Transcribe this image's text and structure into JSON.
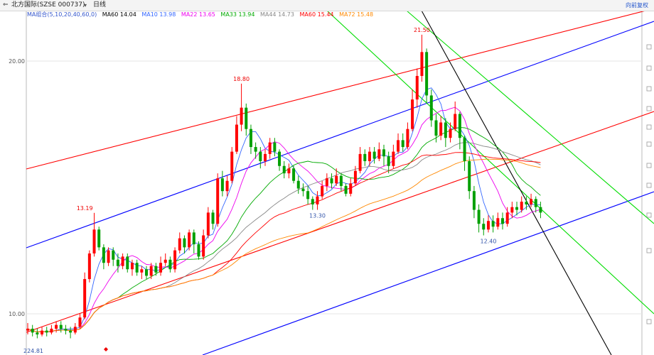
{
  "toolbar": {
    "back_glyph": "⇐",
    "title": "北方国际(SZSE 000737)",
    "period": "日线",
    "adjust_label": "向前复权",
    "period_menu_icon": "chevron-down-icon"
  },
  "ma_legend": {
    "group": "MA组合(5,10,20,40,60,0)",
    "items": [
      {
        "label": "MA60 14.04",
        "color": "#000000"
      },
      {
        "label": "MA10 13.98",
        "color": "#3366ff"
      },
      {
        "label": "MA22 13.65",
        "color": "#ee00ee"
      },
      {
        "label": "MA33 13.94",
        "color": "#00aa00"
      },
      {
        "label": "MA44 14.73",
        "color": "#888888"
      },
      {
        "label": "MA60 15.44",
        "color": "#ff0000"
      },
      {
        "label": "MA72 15.48",
        "color": "#ff8800"
      }
    ]
  },
  "colors": {
    "up": "#ff0000",
    "down": "#00a000",
    "channel_red": "#ff0000",
    "channel_blue": "#0000ff",
    "fan_green": "#00dd00",
    "trend_black": "#000000"
  },
  "chart_data": {
    "type": "candlestick",
    "y_scale": "log",
    "ylim": [
      9.1,
      23.5
    ],
    "y_ticks": [
      10.0,
      20.0
    ],
    "y_tick_labels": [
      "10.00",
      "20.00"
    ],
    "peak_labels": [
      {
        "label": "13.19",
        "day": 12,
        "value": 13.19
      },
      {
        "label": "18.80",
        "day": 45,
        "value": 18.8
      },
      {
        "label": "13.30",
        "day": 61,
        "value": 13.3
      },
      {
        "label": "21.50",
        "day": 83,
        "value": 21.5
      },
      {
        "label": "12.40",
        "day": 97,
        "value": 12.4
      }
    ],
    "bottom_label": "224.81",
    "candles": [
      [
        9.55,
        9.6,
        9.75,
        9.45
      ],
      [
        9.6,
        9.5,
        9.7,
        9.4
      ],
      [
        9.5,
        9.45,
        9.6,
        9.35
      ],
      [
        9.45,
        9.55,
        9.65,
        9.4
      ],
      [
        9.55,
        9.5,
        9.65,
        9.4
      ],
      [
        9.5,
        9.6,
        9.7,
        9.45
      ],
      [
        9.6,
        9.7,
        9.8,
        9.5
      ],
      [
        9.7,
        9.6,
        9.8,
        9.5
      ],
      [
        9.6,
        9.55,
        9.7,
        9.45
      ],
      [
        9.55,
        9.5,
        9.65,
        9.35
      ],
      [
        9.5,
        9.65,
        9.75,
        9.45
      ],
      [
        9.65,
        9.9,
        10.0,
        9.6
      ],
      [
        9.9,
        11.0,
        11.2,
        9.85
      ],
      [
        11.0,
        11.8,
        11.9,
        10.9
      ],
      [
        11.8,
        12.6,
        13.19,
        11.7
      ],
      [
        12.6,
        12.0,
        12.7,
        11.9
      ],
      [
        12.0,
        11.5,
        12.1,
        11.3
      ],
      [
        11.5,
        11.9,
        12.0,
        11.4
      ],
      [
        11.9,
        11.6,
        12.0,
        11.4
      ],
      [
        11.6,
        11.4,
        11.8,
        11.2
      ],
      [
        11.4,
        11.7,
        11.8,
        11.3
      ],
      [
        11.7,
        11.3,
        11.8,
        11.2
      ],
      [
        11.3,
        11.5,
        11.6,
        11.1
      ],
      [
        11.5,
        11.2,
        11.6,
        11.1
      ],
      [
        11.2,
        11.3,
        11.4,
        11.0
      ],
      [
        11.3,
        11.1,
        11.4,
        11.0
      ],
      [
        11.1,
        11.4,
        11.5,
        11.0
      ],
      [
        11.4,
        11.2,
        11.5,
        11.1
      ],
      [
        11.2,
        11.5,
        11.7,
        11.1
      ],
      [
        11.5,
        11.6,
        11.8,
        11.4
      ],
      [
        11.6,
        11.3,
        11.7,
        11.2
      ],
      [
        11.3,
        11.9,
        12.0,
        11.2
      ],
      [
        11.9,
        12.3,
        12.5,
        11.8
      ],
      [
        12.3,
        12.0,
        12.4,
        11.8
      ],
      [
        12.0,
        12.5,
        12.6,
        11.9
      ],
      [
        12.5,
        12.1,
        12.6,
        11.8
      ],
      [
        12.1,
        11.7,
        12.2,
        11.6
      ],
      [
        11.7,
        12.4,
        12.6,
        11.6
      ],
      [
        12.4,
        13.2,
        13.4,
        12.3
      ],
      [
        13.2,
        12.8,
        13.3,
        12.6
      ],
      [
        12.8,
        14.5,
        14.7,
        12.7
      ],
      [
        14.5,
        14.0,
        14.8,
        13.8
      ],
      [
        14.0,
        14.4,
        14.6,
        13.8
      ],
      [
        14.4,
        15.6,
        15.8,
        14.3
      ],
      [
        15.6,
        16.8,
        17.2,
        15.5
      ],
      [
        16.8,
        17.6,
        18.8,
        16.5
      ],
      [
        17.6,
        16.6,
        17.8,
        16.3
      ],
      [
        16.6,
        15.8,
        16.8,
        15.5
      ],
      [
        15.8,
        15.6,
        16.0,
        15.3
      ],
      [
        15.6,
        15.2,
        15.8,
        14.9
      ],
      [
        15.2,
        15.5,
        15.7,
        15.0
      ],
      [
        15.5,
        16.0,
        16.2,
        15.3
      ],
      [
        16.0,
        15.6,
        16.2,
        15.4
      ],
      [
        15.6,
        15.0,
        15.7,
        14.8
      ],
      [
        15.0,
        14.7,
        15.2,
        14.5
      ],
      [
        14.7,
        14.9,
        15.1,
        14.5
      ],
      [
        14.9,
        14.4,
        15.0,
        14.3
      ],
      [
        14.4,
        14.1,
        14.6,
        13.9
      ],
      [
        14.1,
        14.0,
        14.3,
        13.8
      ],
      [
        14.0,
        13.7,
        14.2,
        13.5
      ],
      [
        13.7,
        13.5,
        13.8,
        13.3
      ],
      [
        13.5,
        13.8,
        14.0,
        13.3
      ],
      [
        13.8,
        14.2,
        14.4,
        13.7
      ],
      [
        14.2,
        14.5,
        14.7,
        14.0
      ],
      [
        14.5,
        14.3,
        14.7,
        14.1
      ],
      [
        14.3,
        14.6,
        14.9,
        14.2
      ],
      [
        14.6,
        14.2,
        14.7,
        14.0
      ],
      [
        14.2,
        13.9,
        14.3,
        13.8
      ],
      [
        13.9,
        14.3,
        14.5,
        13.8
      ],
      [
        14.3,
        14.8,
        15.0,
        14.2
      ],
      [
        14.8,
        15.5,
        15.8,
        14.7
      ],
      [
        15.5,
        15.2,
        15.7,
        15.0
      ],
      [
        15.2,
        15.6,
        15.8,
        15.0
      ],
      [
        15.6,
        15.3,
        15.8,
        15.1
      ],
      [
        15.3,
        15.7,
        16.0,
        15.2
      ],
      [
        15.7,
        15.4,
        15.9,
        15.0
      ],
      [
        15.4,
        15.0,
        15.6,
        14.7
      ],
      [
        15.0,
        15.6,
        15.9,
        14.9
      ],
      [
        15.6,
        16.1,
        16.4,
        15.5
      ],
      [
        16.1,
        15.8,
        16.4,
        15.6
      ],
      [
        15.8,
        16.6,
        16.9,
        15.7
      ],
      [
        16.6,
        18.0,
        18.5,
        16.5
      ],
      [
        18.0,
        19.2,
        19.6,
        17.6
      ],
      [
        19.2,
        20.5,
        21.5,
        18.9
      ],
      [
        20.5,
        18.2,
        20.7,
        17.8
      ],
      [
        18.2,
        17.0,
        18.5,
        16.7
      ],
      [
        17.0,
        16.3,
        17.3,
        16.0
      ],
      [
        16.3,
        16.9,
        17.2,
        16.1
      ],
      [
        16.9,
        16.2,
        17.1,
        15.8
      ],
      [
        16.2,
        16.6,
        16.9,
        16.0
      ],
      [
        16.6,
        17.3,
        17.9,
        16.5
      ],
      [
        17.3,
        16.2,
        17.4,
        15.7
      ],
      [
        16.2,
        15.2,
        16.3,
        14.8
      ],
      [
        15.2,
        14.0,
        15.4,
        13.7
      ],
      [
        14.0,
        13.3,
        14.2,
        13.0
      ],
      [
        13.3,
        12.8,
        13.5,
        12.5
      ],
      [
        12.8,
        12.6,
        13.0,
        12.4
      ],
      [
        12.6,
        12.9,
        13.1,
        12.5
      ],
      [
        12.9,
        12.7,
        13.1,
        12.5
      ],
      [
        12.7,
        13.0,
        13.2,
        12.6
      ],
      [
        13.0,
        12.8,
        13.2,
        12.6
      ],
      [
        12.8,
        13.2,
        13.4,
        12.7
      ],
      [
        13.2,
        13.4,
        13.6,
        13.0
      ],
      [
        13.4,
        13.3,
        13.6,
        13.1
      ],
      [
        13.3,
        13.6,
        13.8,
        13.2
      ],
      [
        13.6,
        13.5,
        13.8,
        13.3
      ],
      [
        13.5,
        13.7,
        13.9,
        13.4
      ],
      [
        13.7,
        13.4,
        13.8,
        13.2
      ],
      [
        13.4,
        13.2,
        13.6,
        13.0
      ]
    ]
  }
}
